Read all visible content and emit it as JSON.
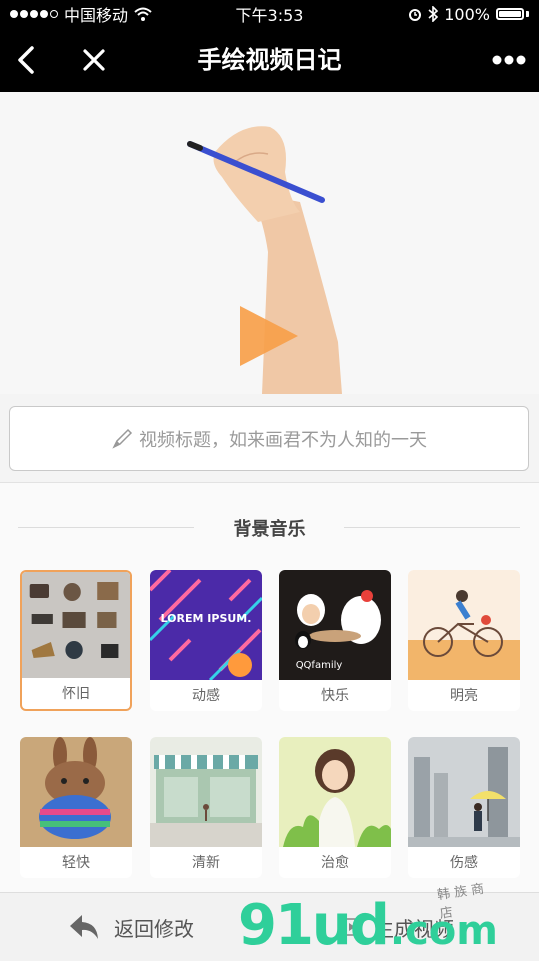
{
  "status_bar": {
    "carrier": "中国移动",
    "time": "下午3:53",
    "battery": "100%"
  },
  "navbar": {
    "title": "手绘视频日记"
  },
  "title_input": {
    "placeholder": "视频标题，如来画君不为人知的一天"
  },
  "music": {
    "heading": "背景音乐",
    "items": [
      {
        "label": "怀旧",
        "selected": true
      },
      {
        "label": "动感",
        "selected": false
      },
      {
        "label": "快乐",
        "selected": false
      },
      {
        "label": "明亮",
        "selected": false
      },
      {
        "label": "轻快",
        "selected": false
      },
      {
        "label": "清新",
        "selected": false
      },
      {
        "label": "治愈",
        "selected": false
      },
      {
        "label": "伤感",
        "selected": false
      }
    ],
    "thumb_text": {
      "lorem": "LOREM IPSUM.",
      "qq": "QQfamily"
    }
  },
  "bottom_bar": {
    "back_label": "返回修改",
    "generate_label": "生成视频"
  },
  "watermark": {
    "main": "91ud",
    "suffix": ".com",
    "sub": "韩 族 商 店"
  },
  "colors": {
    "selected_border": "#f0a25a",
    "play_orange": "#f7a04a",
    "watermark_green": "#2fcf9a"
  }
}
